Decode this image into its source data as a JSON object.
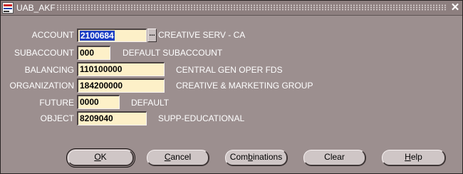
{
  "window": {
    "title": "UAB_AKF",
    "close_glyph": "✕",
    "icon": "oracle-app-icon"
  },
  "fields": [
    {
      "label": "ACCOUNT",
      "value": "2100684",
      "description": "CREATIVE SERV - CA",
      "selected": true
    },
    {
      "label": "SUBACCOUNT",
      "value": "000",
      "description": "DEFAULT SUBACCOUNT"
    },
    {
      "label": "BALANCING",
      "value": "110100000",
      "description": "CENTRAL GEN OPER FDS"
    },
    {
      "label": "ORGANIZATION",
      "value": "184200000",
      "description": "CREATIVE & MARKETING GROUP"
    },
    {
      "label": "FUTURE",
      "value": "0000",
      "description": "DEFAULT"
    },
    {
      "label": "OBJECT",
      "value": "8209040",
      "description": "SUPP-EDUCATIONAL"
    }
  ],
  "lov_button": {
    "label": "..."
  },
  "buttons": {
    "ok": {
      "label": "OK",
      "accel": "O",
      "rest": "K"
    },
    "cancel": {
      "label": "Cancel",
      "accel": "C",
      "rest": "ancel"
    },
    "combinations": {
      "label": "Combinations",
      "pre": "Com",
      "accel": "b",
      "rest": "inations"
    },
    "clear": {
      "label": "Clear"
    },
    "help": {
      "label": "Help",
      "accel": "H",
      "rest": "elp"
    }
  },
  "colors": {
    "window_bg": "#9c8f8f",
    "field_bg": "#fdf0c8",
    "selection": "#1c3fc4"
  }
}
